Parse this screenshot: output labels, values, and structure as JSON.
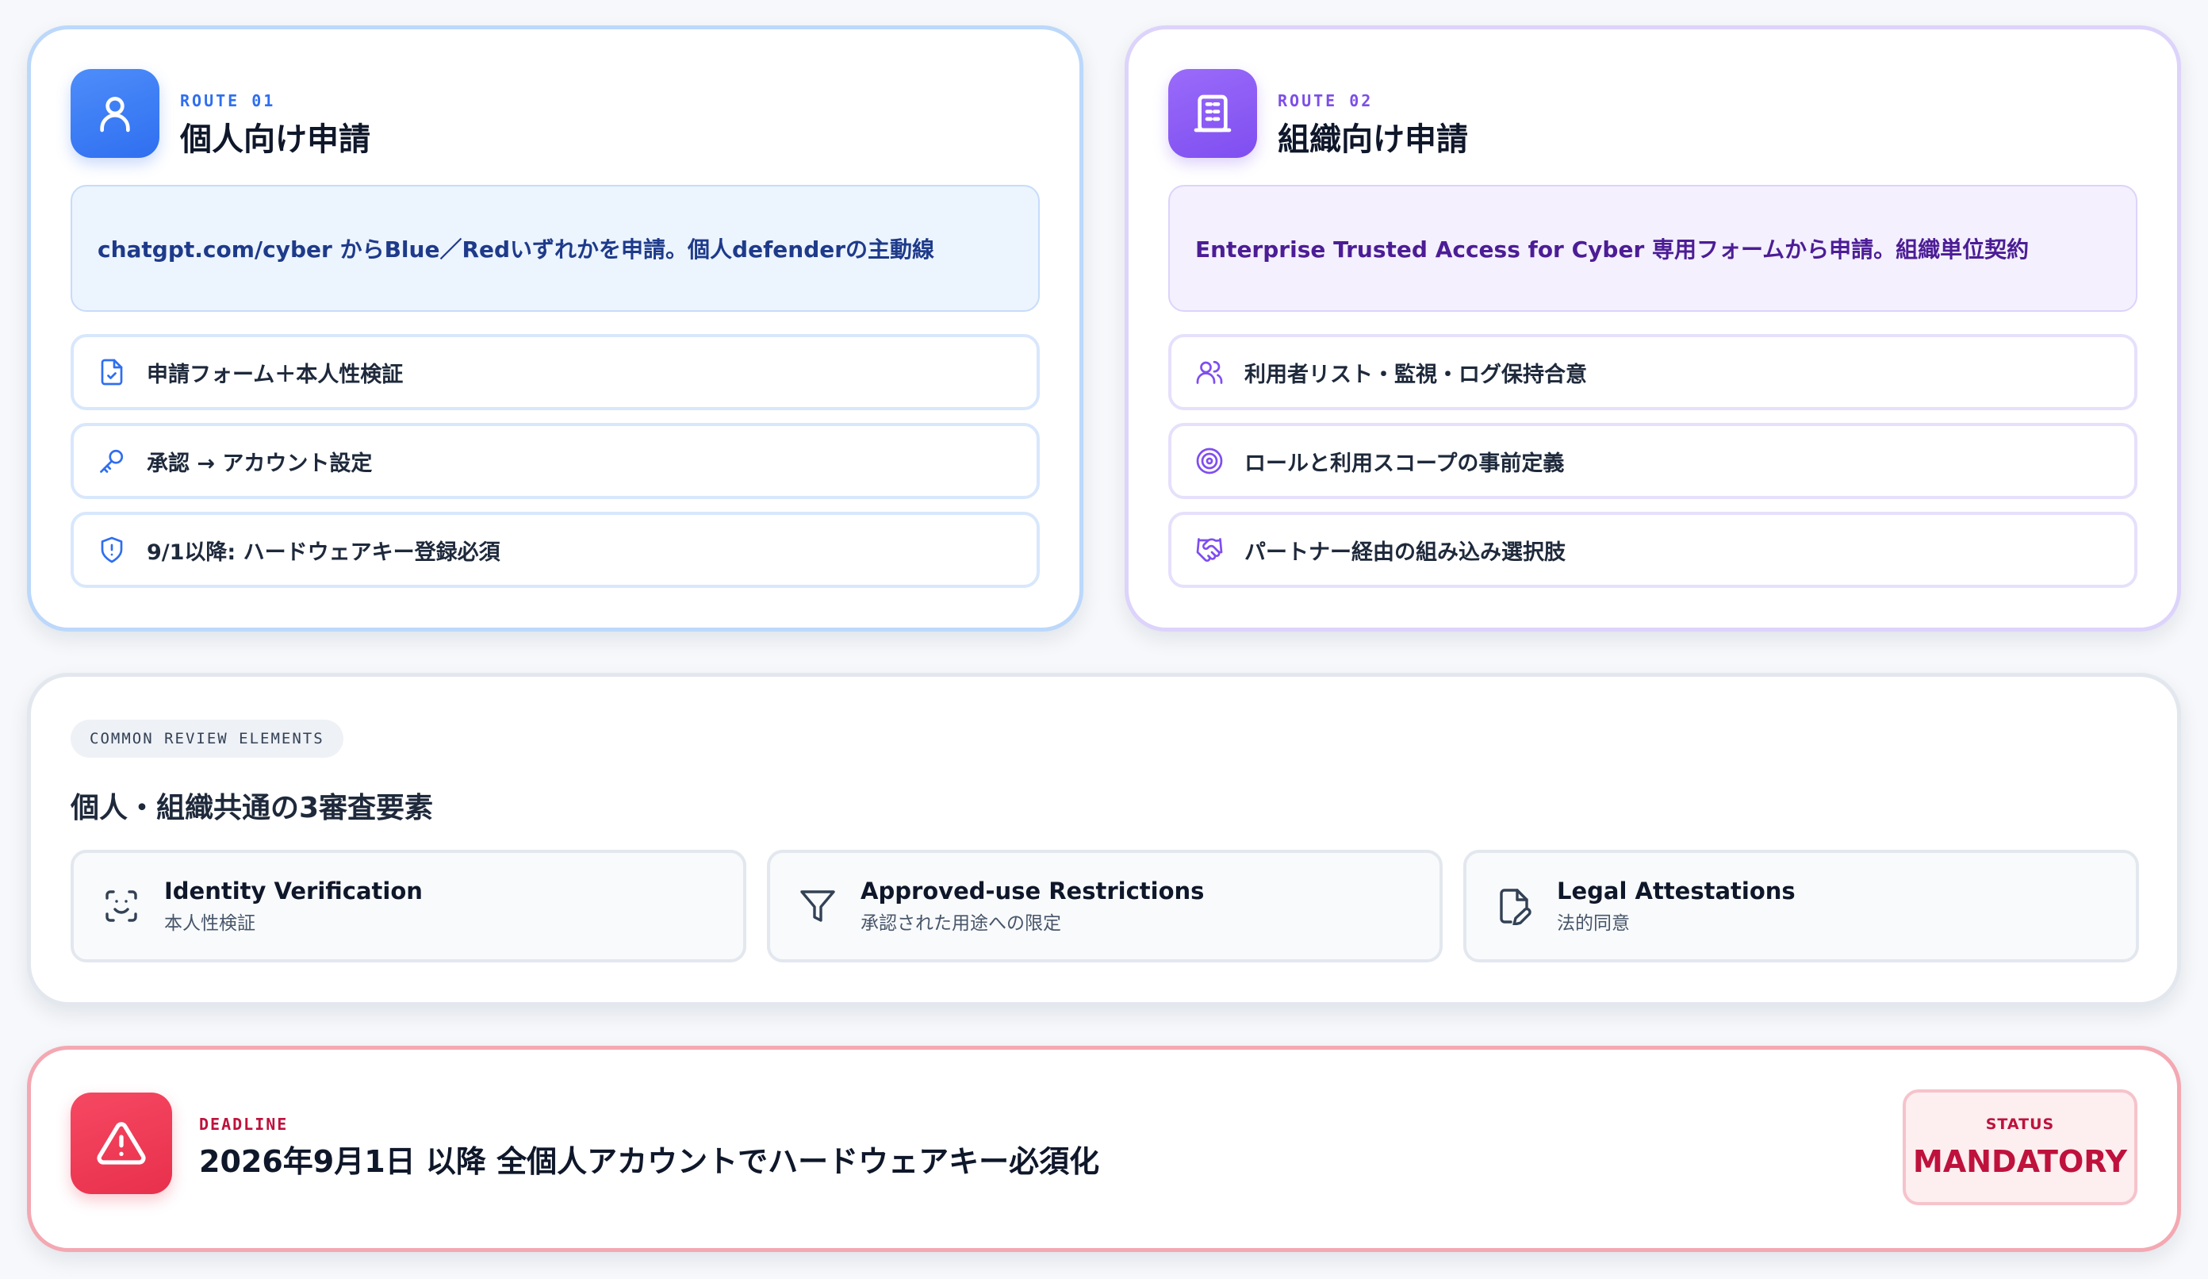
{
  "route_individual": {
    "label": "ROUTE 01",
    "title": "個人向け申請",
    "icon": "user-icon",
    "accent": "#2f6ff0",
    "description": "chatgpt.com/cyber からBlue／Redいずれかを申請。個人defenderの主動線",
    "features": [
      {
        "icon": "file-check-icon",
        "text": "申請フォーム＋本人性検証"
      },
      {
        "icon": "key-icon",
        "text": "承認 → アカウント設定"
      },
      {
        "icon": "shield-alert-icon",
        "text": "9/1以降: ハードウェアキー登録必須"
      }
    ]
  },
  "route_organization": {
    "label": "ROUTE 02",
    "title": "組織向け申請",
    "icon": "building-icon",
    "accent": "#7f4ef0",
    "description": "Enterprise Trusted Access for Cyber 専用フォームから申請。組織単位契約",
    "features": [
      {
        "icon": "users-icon",
        "text": "利用者リスト・監視・ログ保持合意"
      },
      {
        "icon": "target-icon",
        "text": "ロールと利用スコープの事前定義"
      },
      {
        "icon": "handshake-icon",
        "text": "パートナー経由の組み込み選択肢"
      }
    ]
  },
  "common_review": {
    "pill": "COMMON REVIEW ELEMENTS",
    "title": "個人・組織共通の3審査要素",
    "items": [
      {
        "icon": "face-scan-icon",
        "title": "Identity Verification",
        "subtitle": "本人性検証"
      },
      {
        "icon": "filter-icon",
        "title": "Approved-use Restrictions",
        "subtitle": "承認された用途への限定"
      },
      {
        "icon": "file-signature-icon",
        "title": "Legal Attestations",
        "subtitle": "法的同意"
      }
    ]
  },
  "deadline": {
    "label": "DEADLINE",
    "title": "2026年9月1日 以降 全個人アカウントでハードウェアキー必須化",
    "icon": "warning-triangle-icon",
    "accent": "#e8304c",
    "status_label": "STATUS",
    "status_value": "MANDATORY"
  }
}
